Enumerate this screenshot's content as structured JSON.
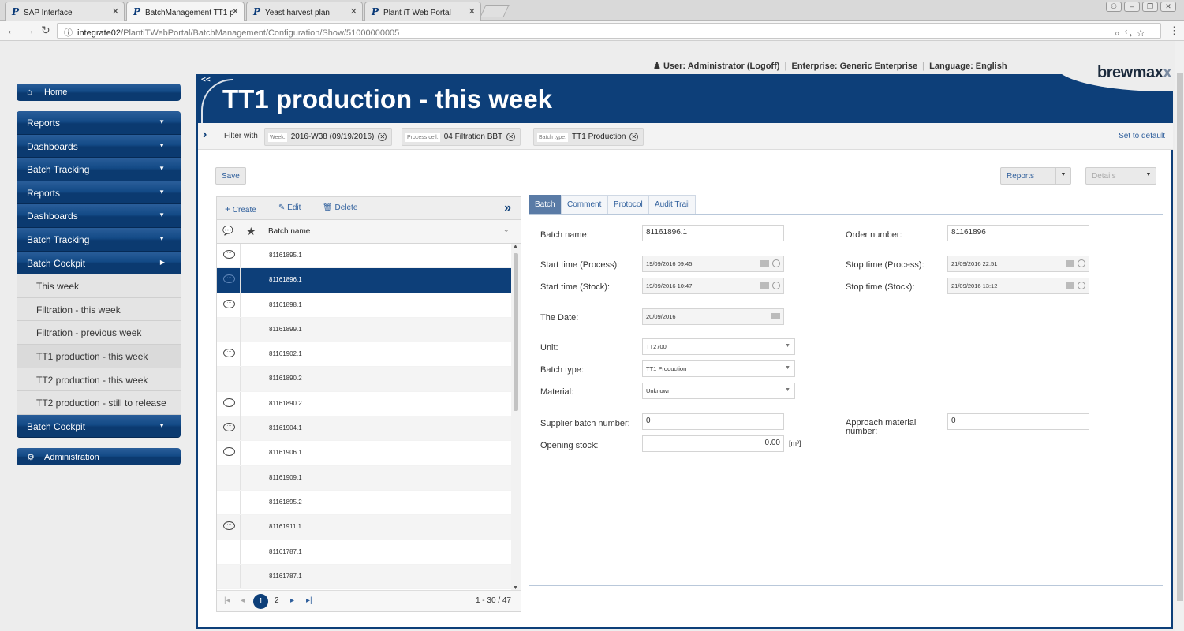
{
  "browser": {
    "tabs": [
      {
        "label": "SAP Interface",
        "active": false
      },
      {
        "label": "BatchManagement TT1 p",
        "active": true
      },
      {
        "label": "Yeast harvest plan",
        "active": false
      },
      {
        "label": "Plant iT Web Portal",
        "active": false
      }
    ],
    "url_host": "integrate02",
    "url_path": "/PlantiTWebPortal/BatchManagement/Configuration/Show/51000000005"
  },
  "topbar": {
    "user": "User: Administrator (Logoff)",
    "enterprise": "Enterprise: Generic Enterprise",
    "language": "Language: English",
    "logo_main": "brewmax",
    "logo_tail": "x"
  },
  "sidebar": {
    "home": "Home",
    "items": [
      {
        "label": "Reports",
        "expanded": false
      },
      {
        "label": "Dashboards",
        "expanded": false
      },
      {
        "label": "Batch Tracking",
        "expanded": false
      },
      {
        "label": "Reports",
        "expanded": false
      },
      {
        "label": "Dashboards",
        "expanded": false
      },
      {
        "label": "Batch Tracking",
        "expanded": false
      },
      {
        "label": "Batch Cockpit",
        "expanded": true
      }
    ],
    "subitems": [
      "This week",
      "Filtration - this week",
      "Filtration - previous week",
      "TT1 production - this week",
      "TT2 production - this week",
      "TT2 production - still to release"
    ],
    "last_item": "Batch Cockpit",
    "administration": "Administration"
  },
  "page": {
    "collapse": "<<",
    "title": "TT1 production - this week"
  },
  "filter": {
    "label": "Filter with",
    "chips": [
      {
        "key": "Week:",
        "value": "2016-W38 (09/19/2016)"
      },
      {
        "key": "Process cell:",
        "value": "04 Filtration BBT"
      },
      {
        "key": "Batch type:",
        "value": "TT1 Production"
      }
    ],
    "set_default": "Set to default"
  },
  "toolbar": {
    "save": "Save",
    "reports": "Reports",
    "details": "Details"
  },
  "grid": {
    "create": "Create",
    "edit": "Edit",
    "delete": "Delete",
    "column": "Batch name",
    "rows": [
      {
        "name": "81161895.1",
        "comment": true
      },
      {
        "name": "81161896.1",
        "comment": true,
        "selected": true
      },
      {
        "name": "81161898.1",
        "comment": true
      },
      {
        "name": "81161899.1",
        "comment": false
      },
      {
        "name": "81161902.1",
        "comment": true
      },
      {
        "name": "81161890.2",
        "comment": false
      },
      {
        "name": "81161890.2",
        "comment": true
      },
      {
        "name": "81161904.1",
        "comment": true
      },
      {
        "name": "81161906.1",
        "comment": true
      },
      {
        "name": "81161909.1",
        "comment": false
      },
      {
        "name": "81161895.2",
        "comment": false
      },
      {
        "name": "81161911.1",
        "comment": true
      },
      {
        "name": "81161787.1",
        "comment": false
      },
      {
        "name": "81161787.1",
        "comment": false
      }
    ],
    "page1": "1",
    "page2": "2",
    "count": "1 - 30 / 47"
  },
  "details": {
    "tabs": [
      "Batch",
      "Comment",
      "Protocol",
      "Audit Trail"
    ],
    "batch_name_label": "Batch name:",
    "batch_name": "81161896.1",
    "order_number_label": "Order number:",
    "order_number": "81161896",
    "start_process_label": "Start time (Process):",
    "start_process": "19/09/2016 09:45",
    "stop_process_label": "Stop time (Process):",
    "stop_process": "21/09/2016 22:51",
    "start_stock_label": "Start time (Stock):",
    "start_stock": "19/09/2016 10:47",
    "stop_stock_label": "Stop time (Stock):",
    "stop_stock": "21/09/2016 13:12",
    "date_label": "The Date:",
    "date": "20/09/2016",
    "unit_label": "Unit:",
    "unit": "TT2700",
    "batch_type_label": "Batch type:",
    "batch_type": "TT1 Production",
    "material_label": "Material:",
    "material": "Unknown",
    "supplier_label": "Supplier batch number:",
    "supplier": "0",
    "approach_label": "Approach material number:",
    "approach": "0",
    "opening_label": "Opening stock:",
    "opening": "0.00",
    "opening_unit": "[m³]"
  }
}
